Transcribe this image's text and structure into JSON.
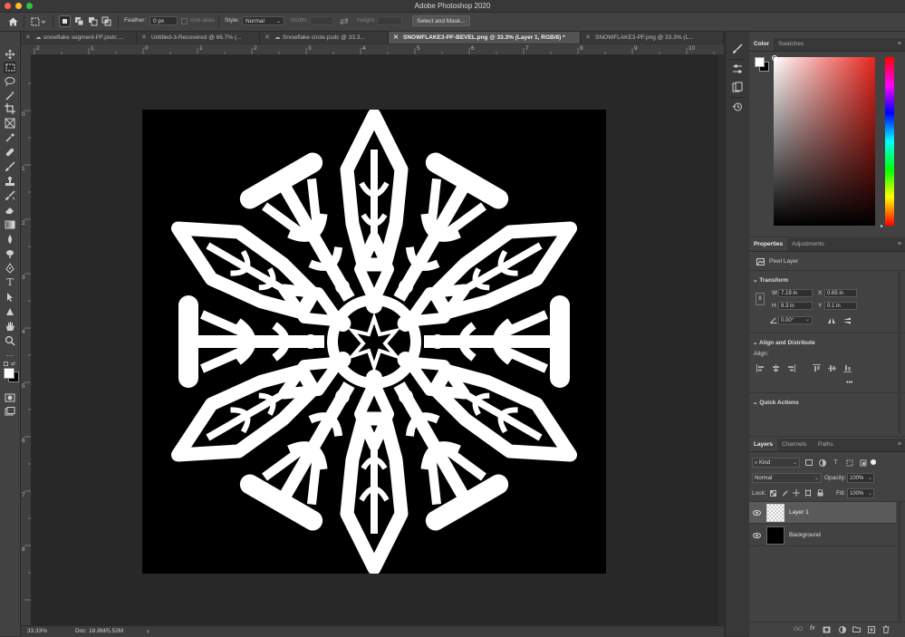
{
  "app": {
    "title": "Adobe Photoshop 2020"
  },
  "options_bar": {
    "feather_label": "Feather:",
    "feather_value": "0 px",
    "antialias_label": "Anti-alias",
    "style_label": "Style:",
    "style_value": "Normal",
    "width_label": "Width:",
    "height_label": "Height:",
    "select_mask_label": "Select and Mask..."
  },
  "tabs": [
    {
      "label": "snowflake segment-PF.psdc ..."
    },
    {
      "label": "Untitled-3-Recovered @ 66.7% (..."
    },
    {
      "label": "Snowflake circle.psdc @ 33.3..."
    },
    {
      "label": "SNOWFLAKE3-PF-BEVEL.png @ 33.3% (Layer 1, RGB/8) *"
    },
    {
      "label": "SNOWFLAKE3-PF.png @ 33.3% (L..."
    }
  ],
  "rulers": {
    "horizontal": [
      "2",
      "1",
      "0",
      "1",
      "2",
      "3",
      "4",
      "5",
      "6",
      "7",
      "8",
      "9",
      "10"
    ],
    "vertical": [
      "0",
      "1",
      "2",
      "3",
      "4",
      "5",
      "6",
      "7",
      "8"
    ]
  },
  "status": {
    "zoom": "33.33%",
    "doc": "Doc: 18.8M/5.52M",
    "arrow": "›"
  },
  "color_panel": {
    "tabs": [
      "Color",
      "Swatches"
    ]
  },
  "properties_panel": {
    "tabs": [
      "Properties",
      "Adjustments"
    ],
    "layer_type": "Pixel Layer",
    "transform_label": "Transform",
    "w_label": "W",
    "w_value": "7.19 in",
    "h_label": "H",
    "h_value": "8.3 in",
    "x_label": "X",
    "x_value": "0.65 in",
    "y_label": "Y",
    "y_value": "0.1 in",
    "angle_value": "0.00°",
    "align_label": "Align and Distribute",
    "align_sub": "Align:",
    "more": "•••",
    "quick_actions_label": "Quick Actions"
  },
  "layers_panel": {
    "tabs": [
      "Layers",
      "Channels",
      "Paths"
    ],
    "filter_kind": "Kind",
    "blend_mode": "Normal",
    "opacity_label": "Opacity:",
    "opacity_value": "100%",
    "lock_label": "Lock:",
    "fill_label": "Fill:",
    "fill_value": "100%",
    "layers": [
      {
        "name": "Layer 1",
        "selected": true
      },
      {
        "name": "Background",
        "selected": false
      }
    ],
    "footer": {
      "link": "GO",
      "fx": "fx"
    }
  },
  "colors": {
    "foreground": "#ffffff",
    "background": "#000000",
    "accent": "#2f7fd6"
  }
}
